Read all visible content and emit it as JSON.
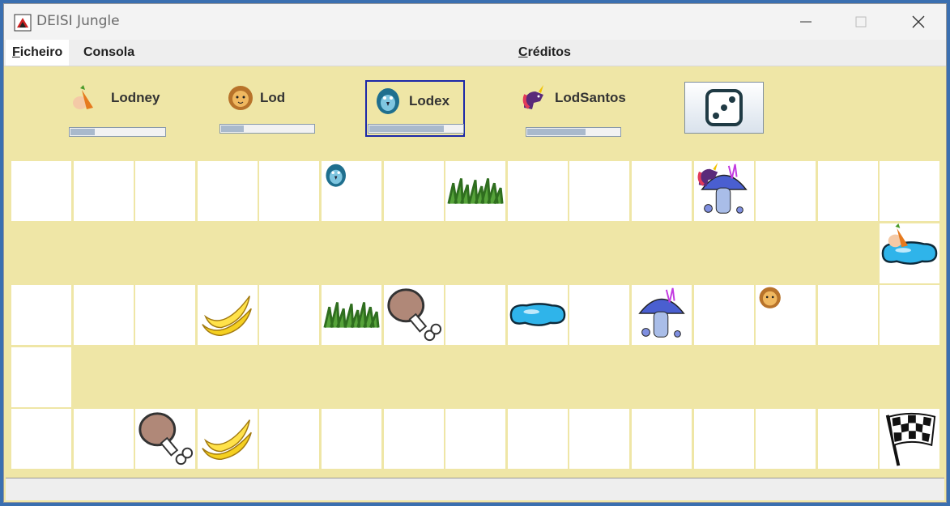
{
  "window": {
    "title": "DEISI Jungle"
  },
  "menu": {
    "items": [
      {
        "label_ul": "F",
        "label_rest": "icheiro",
        "selected": true
      },
      {
        "label_ul": "",
        "label_rest": "Consola",
        "selected": false
      },
      {
        "label_ul": "C",
        "label_rest": "réditos",
        "selected": false
      }
    ]
  },
  "players": [
    {
      "name": "Lodney",
      "icon": "carrot-character-icon",
      "energy": 0.27,
      "active": false
    },
    {
      "name": "Lod",
      "icon": "lion-icon",
      "energy": 0.26,
      "active": false
    },
    {
      "name": "Lodex",
      "icon": "blue-bird-icon",
      "energy": 0.8,
      "active": true
    },
    {
      "name": "LodSantos",
      "icon": "unicorn-icon",
      "energy": 0.64,
      "active": false
    }
  ],
  "dice": {
    "icon": "dice-three-icon"
  },
  "board": {
    "columns": 15,
    "rows": [
      {
        "cells": 15,
        "offset": 0,
        "items": [
          {
            "col": 5,
            "type": "player-bird-token"
          },
          {
            "col": 7,
            "type": "grass-icon"
          },
          {
            "col": 11,
            "type": "mushroom-icon"
          },
          {
            "col": 11,
            "type": "player-unicorn-token"
          }
        ]
      },
      {
        "cells": 1,
        "offset": 14,
        "items": [
          {
            "col": 0,
            "type": "water-puddle-icon"
          },
          {
            "col": 0,
            "type": "player-carrot-token"
          }
        ]
      },
      {
        "cells": 15,
        "offset": 0,
        "items": [
          {
            "col": 3,
            "type": "banana-icon"
          },
          {
            "col": 5,
            "type": "grass-icon"
          },
          {
            "col": 6,
            "type": "meat-icon"
          },
          {
            "col": 8,
            "type": "water-puddle-icon"
          },
          {
            "col": 10,
            "type": "mushroom-icon"
          },
          {
            "col": 12,
            "type": "player-lion-token"
          }
        ]
      },
      {
        "cells": 1,
        "offset": 0,
        "items": []
      },
      {
        "cells": 15,
        "offset": 0,
        "items": [
          {
            "col": 2,
            "type": "meat-icon"
          },
          {
            "col": 3,
            "type": "banana-icon"
          },
          {
            "col": 14,
            "type": "finish-flag-icon"
          }
        ]
      }
    ]
  }
}
